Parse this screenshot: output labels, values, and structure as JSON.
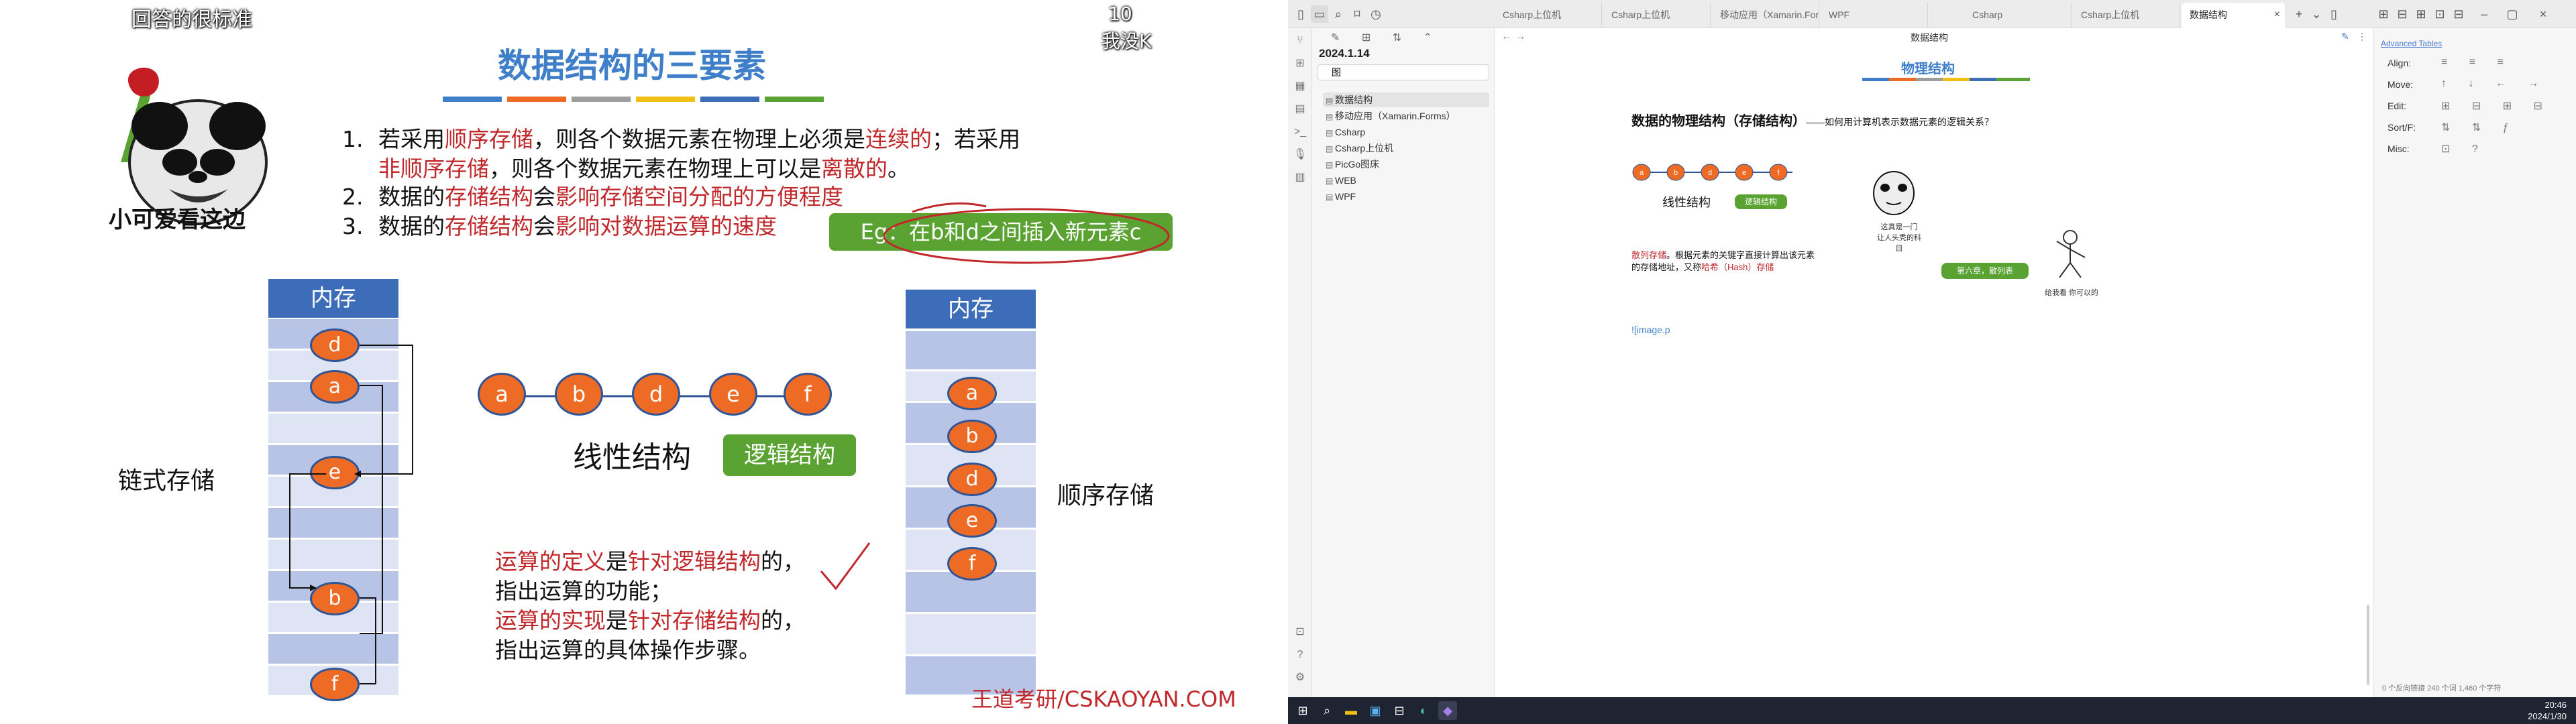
{
  "slide": {
    "watermark_left": "回答的很标准",
    "watermark_right_num": "10",
    "watermark_right_text": "我没K",
    "meme_caption": "小可爱看这边",
    "title": "数据结构的三要素",
    "point1_a": "若采用",
    "point1_b": "顺序存储",
    "point1_c": "，则各个数据元素在物理上必须是",
    "point1_d": "连续的",
    "point1_e": "；若采用",
    "point1_f": "非顺序存储",
    "point1_g": "，则各个数据元素在物理上可以是",
    "point1_h": "离散的",
    "point1_i": "。",
    "point2_a": "数据的",
    "point2_b": "存储结构",
    "point2_c": "会",
    "point2_d": "影响存储空间分配的方便程度",
    "point3_a": "数据的",
    "point3_b": "存储结构",
    "point3_c": "会",
    "point3_d": "影响对数据运算的速度",
    "eg_label": "Eg：在b和d之间插入新元素c",
    "memory_label": "内存",
    "linked_storage": "链式存储",
    "sequential_storage": "顺序存储",
    "linear_structure": "线性结构",
    "logical_structure": "逻辑结构",
    "linked_nodes": [
      "d",
      "a",
      "e",
      "b",
      "f"
    ],
    "linear_nodes": [
      "a",
      "b",
      "d",
      "e",
      "f"
    ],
    "seq_nodes": [
      "a",
      "b",
      "d",
      "e",
      "f"
    ],
    "ops_line1_a": "运算的定义",
    "ops_line1_b": "是",
    "ops_line1_c": "针对逻辑结构",
    "ops_line1_d": "的，",
    "ops_line2": "指出运算的功能；",
    "ops_line3_a": "运算的实现",
    "ops_line3_b": "是",
    "ops_line3_c": "针对存储结构",
    "ops_line3_d": "的，",
    "ops_line4": "指出运算的具体操作步骤。",
    "footer": "王道考研/CSKAOYAN.COM"
  },
  "obsidian": {
    "tabs": [
      {
        "label": "Csharp上位机"
      },
      {
        "label": "Csharp上位机"
      },
      {
        "label": "移动应用（Xamarin.Form..."
      },
      {
        "label": "WPF"
      },
      {
        "label": "Csharp"
      },
      {
        "label": "Csharp上位机"
      },
      {
        "label": "数据结构",
        "active": true
      }
    ],
    "explorer_date": "2024.1.14",
    "explorer_search": "图",
    "explorer_items": [
      "数据结构",
      "移动应用（Xamarin.Forms）",
      "Csharp",
      "Csharp上位机",
      "PicGo图床",
      "WEB",
      "WPF"
    ],
    "doc_title": "数据结构",
    "embedded": {
      "title": "物理结构",
      "heading": "数据的物理结构（存储结构）",
      "subheading": "——如何用计算机表示数据元素的逻辑关系？",
      "linear_label": "线性结构",
      "logic_tag": "逻辑结构",
      "meme_caption1": "这真是一门",
      "meme_caption2": "让人头秃的科目",
      "hash_text1": "散列存储",
      "hash_text2": "。根据元素的关键字直接计算出该元素",
      "hash_text3": "的存储地址，又称",
      "hash_text4": "哈希（Hash）存储",
      "chapter_tag": "第六章，散列表",
      "stick_caption": "给我看  你可以的",
      "nodes": [
        "a",
        "b",
        "d",
        "e",
        "f"
      ]
    },
    "editor_cursor_text": "![image.p",
    "right_panel": {
      "plugin": "Advanced Tables",
      "rows": [
        "Align:",
        "Move:",
        "Edit:",
        "Sort/F:",
        "Misc:"
      ]
    },
    "status_bar": "0 个反向链接   240 个词  1,460 个字符",
    "taskbar_time": "20:46",
    "taskbar_date": "2024/1/30"
  }
}
